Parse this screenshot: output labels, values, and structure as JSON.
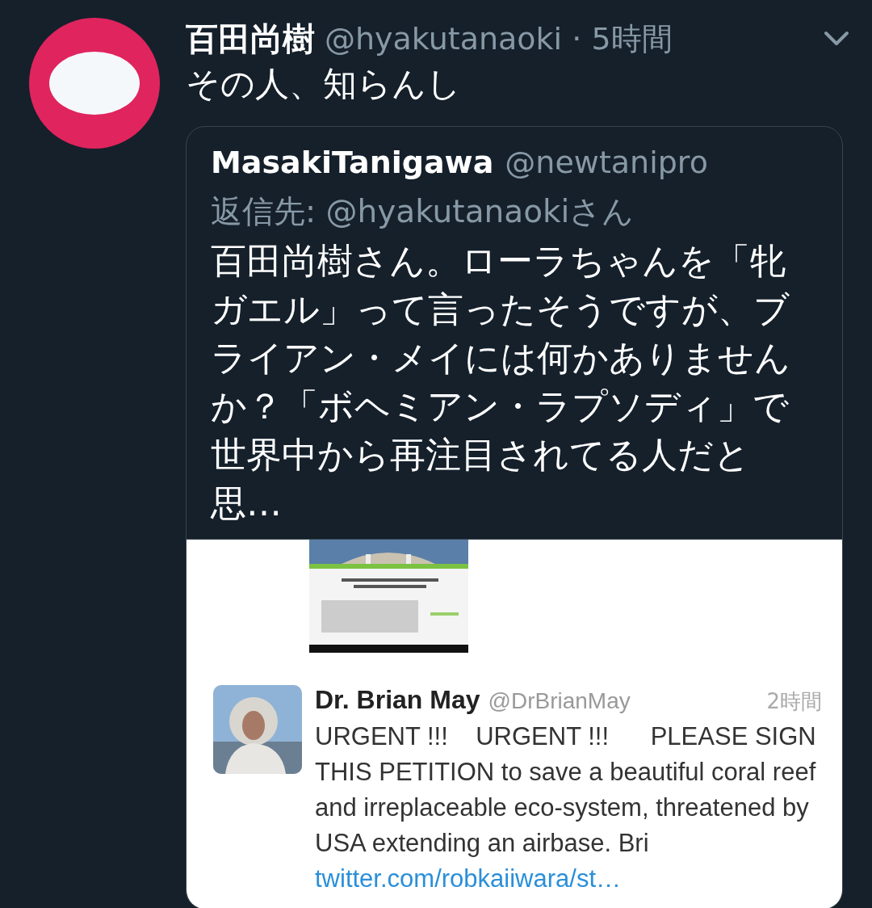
{
  "tweet": {
    "author": "百田尚樹",
    "handle": "@hyakutanaoki",
    "separator": "·",
    "time": "5時間",
    "text": "その人、知らんし"
  },
  "quoted_tweet": {
    "author": "MasakiTanigawa",
    "handle": "@newtanipro",
    "reply_to": "返信先: @hyakutanaokiさん",
    "text": "百田尚樹さん。ローラちゃんを「牝ガエル」って言ったそうですが、ブライアン・メイには何かありませんか？「ボヘミアン・ラプソディ」で世界中から再注目されてる人だと思…",
    "image": {
      "kind": "screenshot",
      "embedded_tweet": {
        "author": "Dr. Brian May",
        "handle": "@DrBrianMay",
        "time": "2時間",
        "text": "URGENT !!!    URGENT !!!      PLEASE SIGN THIS PETITION to save a beautiful coral reef and irreplaceable eco-system, threatened by USA extending an airbase. Bri",
        "link": "twitter.com/robkaiiwara/st…"
      }
    }
  }
}
